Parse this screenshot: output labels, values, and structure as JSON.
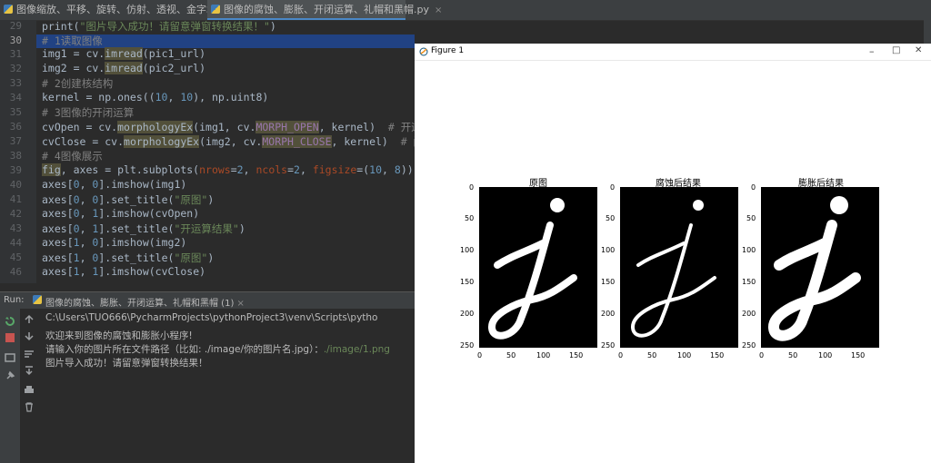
{
  "tabs": [
    {
      "label": "图像缩放、平移、旋转、仿射、透视、金字塔.py",
      "close": "×"
    },
    {
      "label": "图像的腐蚀、膨胀、开闭运算、礼帽和黑帽.py",
      "close": "×"
    }
  ],
  "editor": {
    "line_numbers": [
      "29",
      "30",
      "31",
      "32",
      "33",
      "34",
      "35",
      "36",
      "37",
      "38",
      "39",
      "40",
      "41",
      "42",
      "43",
      "44",
      "45",
      "46"
    ],
    "lines": [
      {
        "a": "print(",
        "b": "\"图片导入成功！请留意弹窗转换结果！\"",
        "c": ")"
      },
      {
        "a": "# 1读取图像"
      },
      {
        "a": "img1 = cv.",
        "b": "imread",
        "c": "(pic1_url)"
      },
      {
        "a": "img2 = cv.",
        "b": "imread",
        "c": "(pic2_url)"
      },
      {
        "a": "# 2创建核结构"
      },
      {
        "a": "kernel = np.ones((",
        "b": "10",
        "c": ", ",
        "d": "10",
        "e": "), np.uint8)"
      },
      {
        "a": "# 3图像的开闭运算"
      },
      {
        "a": "cvOpen = cv.",
        "b": "morphologyEx",
        "c": "(img1, cv.",
        "d": "MORPH_OPEN",
        "e": ", kernel)  ",
        "f": "# 开运算"
      },
      {
        "a": "cvClose = cv.",
        "b": "morphologyEx",
        "c": "(img2, cv.",
        "d": "MORPH_CLOSE",
        "e": ", kernel)  ",
        "f": "# 闭运算"
      },
      {
        "a": "# 4图像展示"
      },
      {
        "a": "fig",
        "b": ", axes = plt.subplots(",
        "c": "nrows",
        "d": "=",
        "e": "2",
        "f": ", ",
        "g": "ncols",
        "h": "=",
        "i": "2",
        "j": ", ",
        "k": "figsize",
        "l": "=(",
        "m": "10",
        "n": ", ",
        "o": "8",
        "p": "))"
      },
      {
        "a": "axes[",
        "b": "0",
        "c": ", ",
        "d": "0",
        "e": "].imshow(img1)"
      },
      {
        "a": "axes[",
        "b": "0",
        "c": ", ",
        "d": "0",
        "e": "].set_title(",
        "f": "\"原图\"",
        "g": ")"
      },
      {
        "a": "axes[",
        "b": "0",
        "c": ", ",
        "d": "1",
        "e": "].imshow(cvOpen)"
      },
      {
        "a": "axes[",
        "b": "0",
        "c": ", ",
        "d": "1",
        "e": "].set_title(",
        "f": "\"开运算结果\"",
        "g": ")"
      },
      {
        "a": "axes[",
        "b": "1",
        "c": ", ",
        "d": "0",
        "e": "].imshow(img2)"
      },
      {
        "a": "axes[",
        "b": "1",
        "c": ", ",
        "d": "0",
        "e": "].set_title(",
        "f": "\"原图\"",
        "g": ")"
      },
      {
        "a": "axes[",
        "b": "1",
        "c": ", ",
        "d": "1",
        "e": "].imshow(cvClose)"
      }
    ]
  },
  "run": {
    "label": "Run:",
    "tab": "图像的腐蚀、膨胀、开闭运算、礼帽和黑帽 (1)",
    "tab_close": "×",
    "console": [
      "C:\\Users\\TUO666\\PycharmProjects\\pythonProject3\\venv\\Scripts\\pytho",
      "欢迎来到图像的腐蚀和膨胀小程序!",
      "请输入你的图片所在文件路径（比如: ./image/你的图片名.jpg）：",
      "图片导入成功！请留意弹窗转换结果！"
    ],
    "console_input": "./image/1.png"
  },
  "figure": {
    "title": "Figure 1",
    "controls": {
      "minimize": "–",
      "maximize": "□",
      "close": "✕"
    },
    "subplots": [
      {
        "title": "原图"
      },
      {
        "title": "腐蚀后结果"
      },
      {
        "title": "膨胀后结果"
      }
    ],
    "y_ticks": [
      "0",
      "50",
      "100",
      "150",
      "200",
      "250"
    ],
    "x_ticks": [
      "0",
      "50",
      "100",
      "150"
    ]
  }
}
